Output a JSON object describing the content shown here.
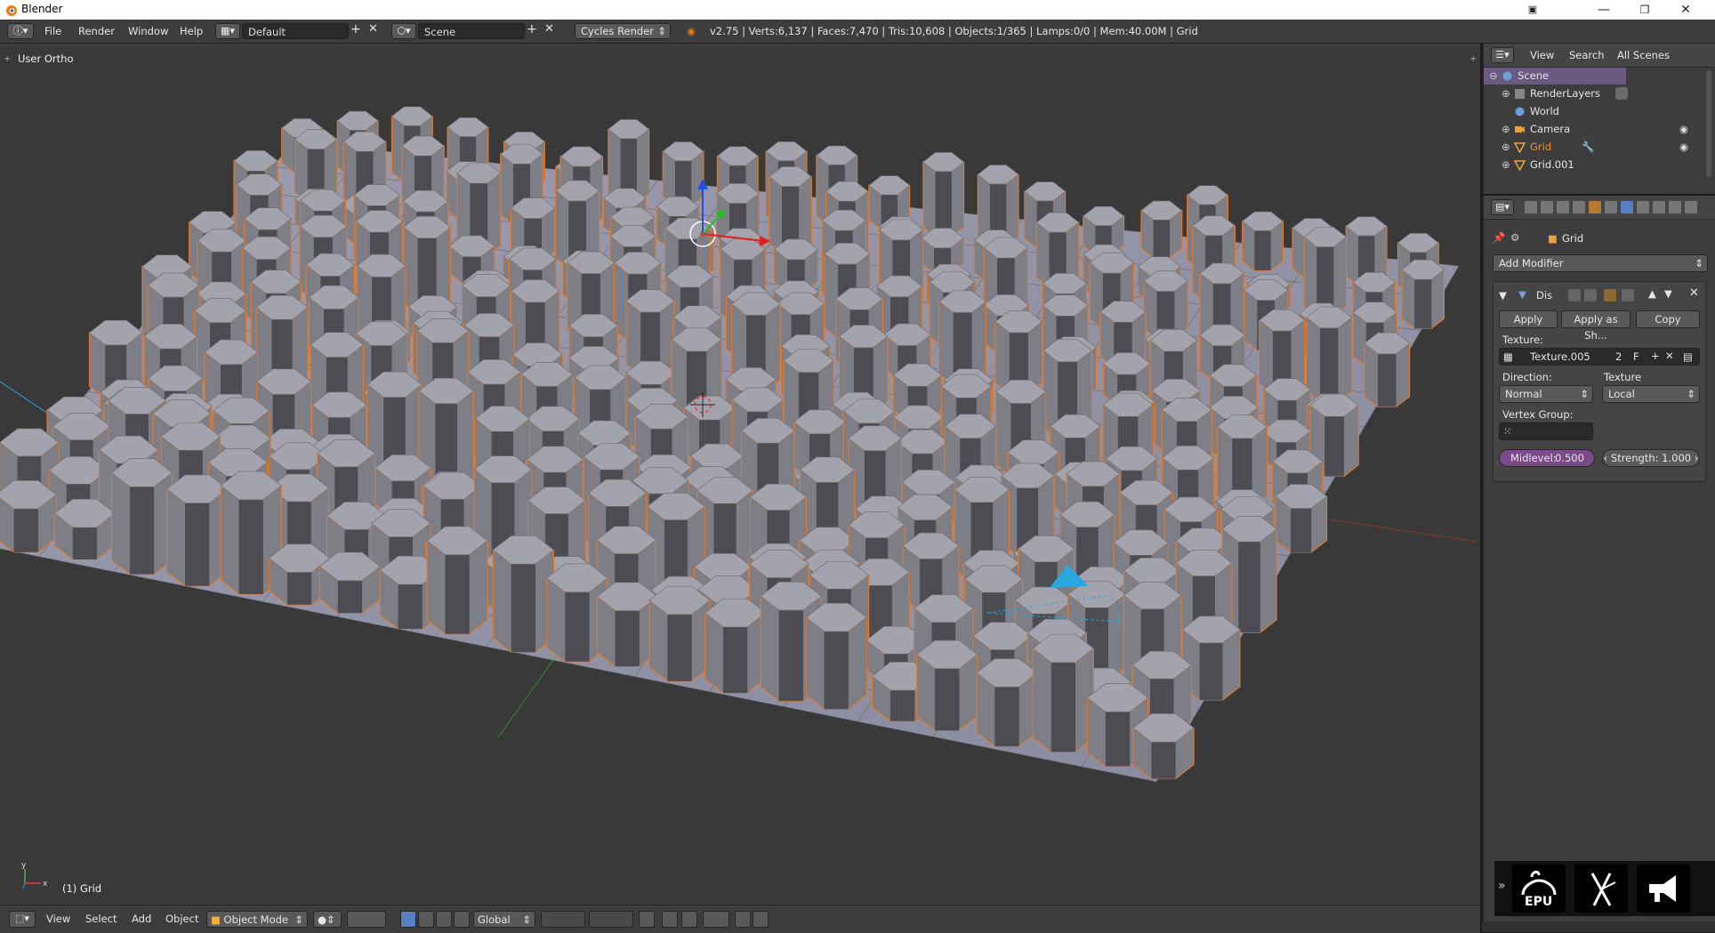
{
  "window": {
    "title": "Blender",
    "controls": [
      "min",
      "max",
      "close"
    ]
  },
  "topbar": {
    "menus": [
      "File",
      "Render",
      "Window",
      "Help"
    ],
    "layout": "Default",
    "scene": "Scene",
    "engine": "Cycles Render",
    "stats": "v2.75 | Verts:6,137 | Faces:7,470 | Tris:10,608 | Objects:1/365 | Lamps:0/0 | Mem:40.00M | Grid"
  },
  "viewport": {
    "view_label": "User Ortho",
    "object_label": "(1) Grid"
  },
  "bottombar": {
    "menus": [
      "View",
      "Select",
      "Add",
      "Object"
    ],
    "mode": "Object Mode",
    "orientation": "Global"
  },
  "outliner": {
    "header": {
      "view": "View",
      "search": "Search",
      "filter": "All Scenes"
    },
    "items": [
      "Scene",
      "RenderLayers",
      "World",
      "Camera",
      "Grid",
      "Grid.001"
    ]
  },
  "properties": {
    "context": "Grid",
    "add_modifier": "Add Modifier",
    "modifier_name": "Dis",
    "apply": "Apply",
    "apply_shape": "Apply as Sh...",
    "copy": "Copy",
    "texture_label": "Texture:",
    "texture_value": "Texture.005",
    "texture_users": "2",
    "fake_user": "F",
    "direction_label": "Direction:",
    "direction_value": "Normal",
    "coords_label": "Texture Coordinates:",
    "coords_value": "Local",
    "vgroup_label": "Vertex Group:",
    "midlevel_label": "Midlevel:",
    "midlevel_value": "0.500",
    "strength": "Strength: 1.000"
  },
  "colors": {
    "accent": "#5680c2",
    "selection_orange": "#f08630",
    "midlevel_blue": "#7a4a8a"
  }
}
